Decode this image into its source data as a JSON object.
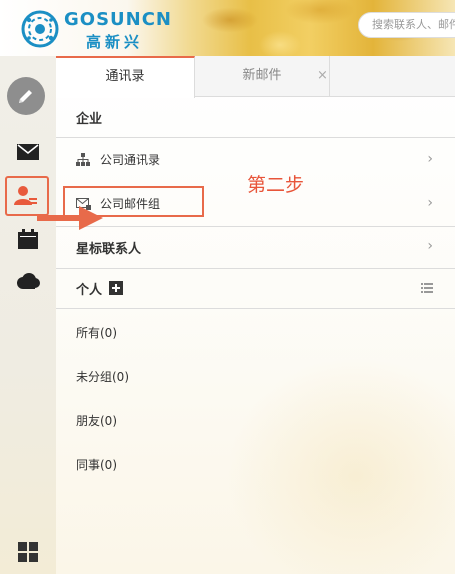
{
  "header": {
    "logo_text": "GOSUNCN",
    "logo_cn": "高新兴",
    "search_placeholder": "搜索联系人、邮件"
  },
  "rail": {
    "items": [
      "compose-icon",
      "mail-icon",
      "contacts-icon",
      "calendar-icon",
      "cloud-icon",
      "apps-grid-icon"
    ],
    "active": "contacts-icon",
    "accent": "#e86a4a"
  },
  "tabs": [
    {
      "label": "通讯录",
      "active": true
    },
    {
      "label": "新邮件",
      "active": false,
      "close": "×"
    }
  ],
  "enterprise": {
    "title": "企业",
    "items": [
      {
        "label": "公司通讯录",
        "icon": "org-chart-icon"
      },
      {
        "label": "公司邮件组",
        "icon": "mail-group-icon"
      }
    ]
  },
  "starred": {
    "title": "星标联系人"
  },
  "personal": {
    "title": "个人",
    "groups": [
      "所有(0)",
      "未分组(0)",
      "朋友(0)",
      "同事(0)"
    ]
  },
  "annotation": {
    "text": "第二步",
    "color": "#e8553a"
  }
}
